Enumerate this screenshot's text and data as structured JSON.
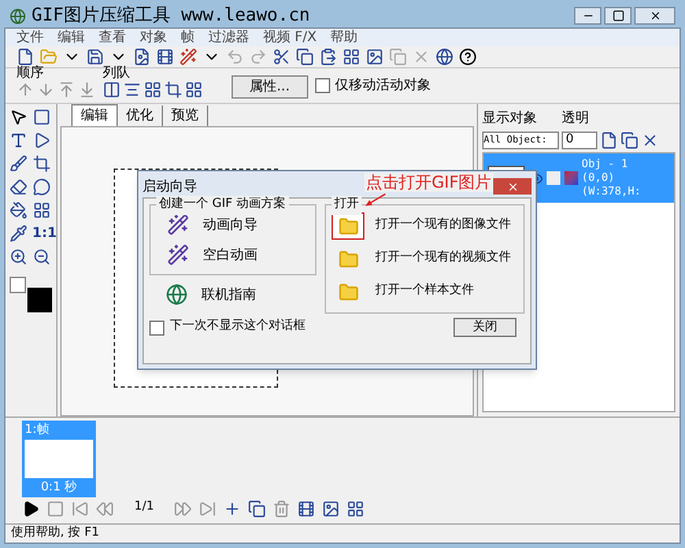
{
  "window": {
    "title": "GIF图片压缩工具 www.leawo.cn"
  },
  "menu": [
    "文件",
    "编辑",
    "查看",
    "对象",
    "帧",
    "过滤器",
    "视频 F/X",
    "帮助"
  ],
  "toolbar2": {
    "order_label": "顺序",
    "queue_label": "列队",
    "properties_button": "属性...",
    "move_active_only": {
      "label": "仅移动活动对象",
      "checked": false
    }
  },
  "tools": {
    "actual_size_label": "1:1"
  },
  "tabs": [
    {
      "label": "编辑",
      "selected": true
    },
    {
      "label": "优化",
      "selected": false
    },
    {
      "label": "预览",
      "selected": false
    }
  ],
  "object_panel": {
    "show_objects_label": "显示对象",
    "transparency_label": "透明",
    "object_filter": "All Object:",
    "transparency_value": "0",
    "objects": [
      {
        "name": "Obj - 1",
        "info": "(0,0)(W:378,H:",
        "selected": true
      }
    ]
  },
  "dialog": {
    "title": "启动向导",
    "create_group": {
      "title": "创建一个 GIF 动画方案",
      "items": [
        "动画向导",
        "空白动画"
      ]
    },
    "online_guide": "联机指南",
    "open_group": {
      "title": "打开",
      "items": [
        {
          "label": "打开一个现有的图像文件",
          "highlighted": true
        },
        {
          "label": "打开一个现有的视频文件",
          "highlighted": false
        },
        {
          "label": "打开一个样本文件",
          "highlighted": false
        }
      ]
    },
    "dont_show": {
      "label": "下一次不显示这个对话框",
      "checked": false
    },
    "close_button": "关闭",
    "annotation": "点击打开GIF图片"
  },
  "frames": [
    {
      "label": "1:帧",
      "delay": "0:1 秒",
      "selected": true
    }
  ],
  "frame_counter": "1/1",
  "status_bar": "使用帮助, 按 F1"
}
